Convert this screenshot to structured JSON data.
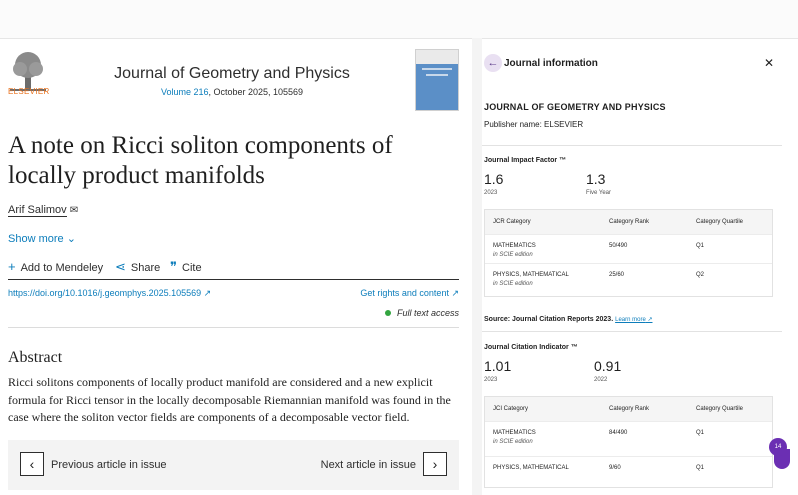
{
  "article": {
    "journal_title": "Journal of Geometry and Physics",
    "volume_link": "Volume 216",
    "issue_info": ", October 2025, 105569",
    "publisher_logo_text": "ELSEVIER",
    "title": "A note on Ricci soliton components of locally product manifolds",
    "author": "Arif Salimov",
    "show_more": "Show more",
    "actions": {
      "mendeley": "Add to Mendeley",
      "share": "Share",
      "cite": "Cite"
    },
    "doi": "https://doi.org/10.1016/j.geomphys.2025.105569 ↗",
    "rights": "Get rights and content ↗",
    "full_text": "Full text access",
    "abstract_heading": "Abstract",
    "abstract_text": "Ricci solitons components of locally product manifold are considered and a new explicit formula for Ricci tensor in the locally decomposable Riemannian manifold was found in the case where the soliton vector fields are components of a decomposable vector field.",
    "prev_label": "Previous article in issue",
    "next_label": "Next article in issue"
  },
  "panel": {
    "title": "Journal information",
    "journal_name": "JOURNAL OF GEOMETRY AND PHYSICS",
    "publisher": "Publisher name: ELSEVIER",
    "jif_heading": "Journal Impact Factor ™",
    "jif": {
      "v1": "1.6",
      "y1": "2023",
      "v2": "1.3",
      "y2": "Five Year"
    },
    "jcr_headers": {
      "c1": "JCR Category",
      "c2": "Category Rank",
      "c3": "Category Quartile"
    },
    "jcr_rows": [
      {
        "cat": "MATHEMATICS",
        "ed": "in SCIE edition",
        "rank": "50/490",
        "q": "Q1"
      },
      {
        "cat": "PHYSICS, MATHEMATICAL",
        "ed": "in SCIE edition",
        "rank": "25/60",
        "q": "Q2"
      }
    ],
    "source": "Source: Journal Citation Reports  2023.",
    "learn_more": "Learn more",
    "jci_heading": "Journal Citation Indicator ™",
    "jci": {
      "v1": "1.01",
      "y1": "2023",
      "v2": "0.91",
      "y2": "2022"
    },
    "jci_headers": {
      "c1": "JCI Category",
      "c2": "Category Rank",
      "c3": "Category Quartile"
    },
    "jci_rows": [
      {
        "cat": "MATHEMATICS",
        "ed": "in SCIE edition",
        "rank": "84/490",
        "q": "Q1"
      },
      {
        "cat": "PHYSICS, MATHEMATICAL",
        "ed": "",
        "rank": "9/60",
        "q": "Q1"
      }
    ],
    "badge": "14"
  }
}
